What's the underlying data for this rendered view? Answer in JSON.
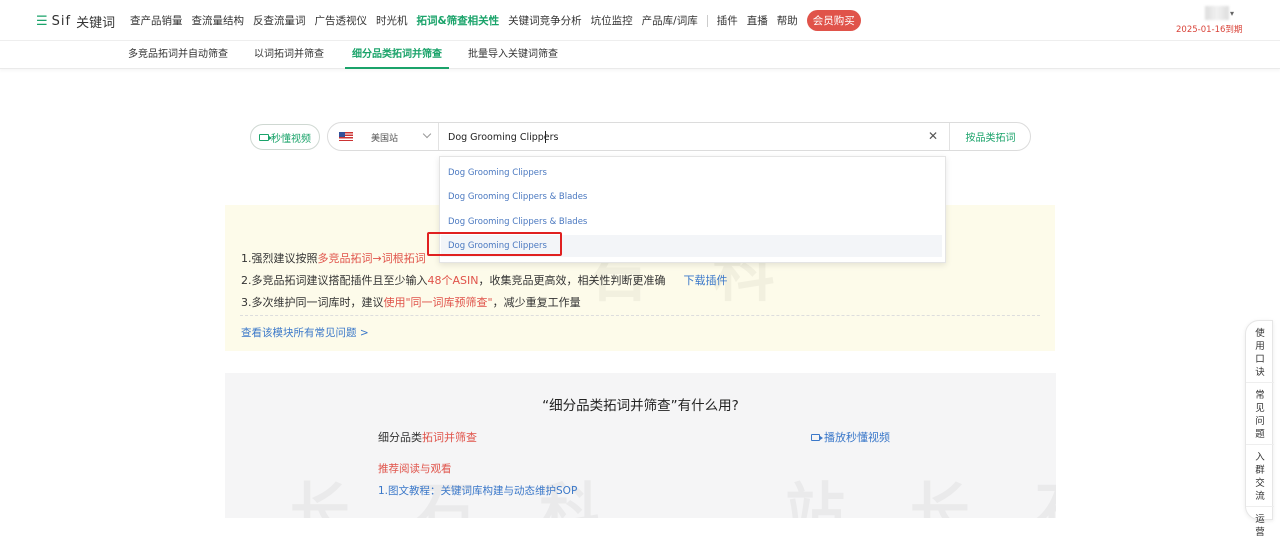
{
  "app": {
    "logo_text": "Sif",
    "logo_suffix": "关键词",
    "expiry": "2025-01-16到期"
  },
  "nav": {
    "items": [
      "查产品销量",
      "查流量结构",
      "反查流量词",
      "广告透视仪",
      "时光机",
      "拓词&筛查相关性",
      "关键词竞争分析",
      "坑位监控",
      "产品库/词库"
    ],
    "active_index": 5,
    "extra": [
      "插件",
      "直播",
      "帮助"
    ],
    "vip_label": "会员购买"
  },
  "subnav": {
    "tabs": [
      "多竞品拓词并自动筛查",
      "以词拓词并筛查",
      "细分品类拓词并筛查",
      "批量导入关键词筛查"
    ],
    "active_index": 2
  },
  "search": {
    "video_label": "秒懂视频",
    "site_label": "美国站",
    "query": "Dog Grooming Clippers",
    "button_label": "按品类拓词"
  },
  "suggestions": [
    "Dog Grooming Clippers",
    "Dog Grooming Clippers & Blades",
    "Dog Grooming Clippers & Blades",
    "Dog Grooming Clippers"
  ],
  "tips": {
    "line1_prefix": "1.强烈建议按照",
    "line1_red": "多竞品拓词→词根拓词",
    "line2_prefix": "2.多竞品拓词建议搭配插件且至少输入",
    "line2_red": "48个ASIN",
    "line2_suffix": "，收集竞品更高效，相关性判断更准确",
    "line2_link": "下载插件",
    "line3_prefix": "3.多次维护同一词库时，建议",
    "line3_red": "使用\"同一词库预筛查\"",
    "line3_suffix": "，减少重复工作量",
    "faq_link": "查看该模块所有常见问题 >"
  },
  "info": {
    "title": "“细分品类拓词并筛查”有什么用?",
    "sub_prefix": "细分品类",
    "sub_red": "拓词并筛查",
    "play_link": "播放秒懂视频",
    "rec_head": "推荐阅读与观看",
    "rec_link": "1.图文教程：关键词库构建与动态维护SOP"
  },
  "float_side": [
    "使用口诀",
    "常见问题",
    "入群交流",
    "运营"
  ],
  "colors": {
    "accent": "#1aa36a",
    "vip": "#e0534a",
    "link": "#3b78c9",
    "highlight": "#e02020"
  }
}
